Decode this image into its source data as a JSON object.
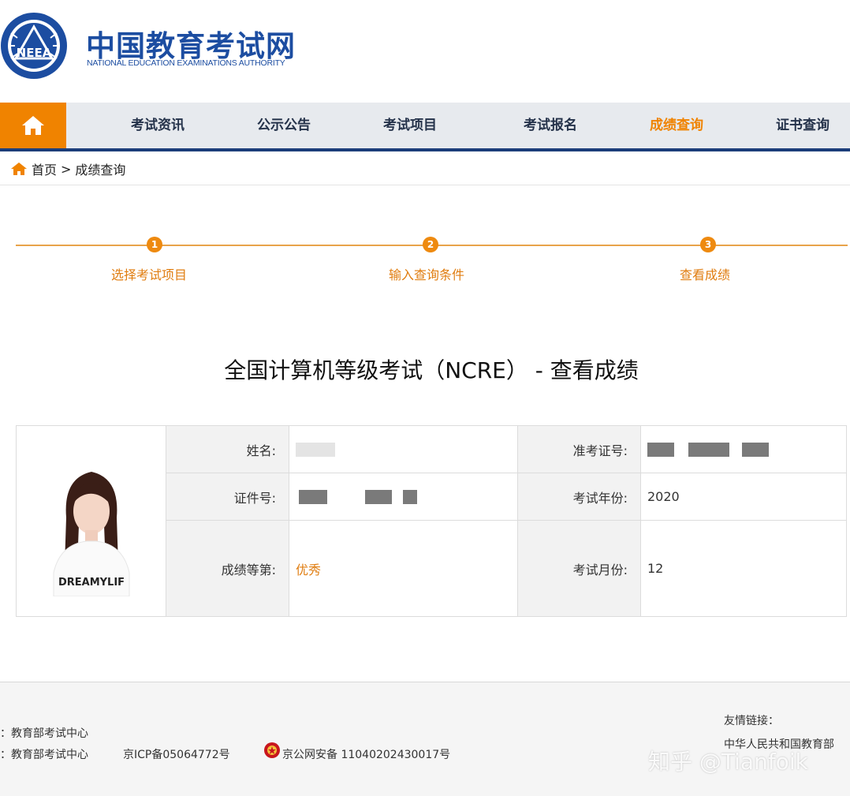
{
  "header": {
    "logo_text": "NEEA",
    "site_title": "中国教育考试网",
    "site_subtitle": "NATIONAL EDUCATION EXAMINATIONS AUTHORITY"
  },
  "nav": {
    "home_icon": "home-icon",
    "items": [
      {
        "label": "考试资讯"
      },
      {
        "label": "公示公告"
      },
      {
        "label": "考试项目"
      },
      {
        "label": "考试报名"
      },
      {
        "label": "成绩查询"
      },
      {
        "label": "证书查询"
      }
    ],
    "active_index": 4
  },
  "breadcrumb": {
    "home": "首页",
    "separator": ">",
    "current": "成绩查询"
  },
  "steps": [
    {
      "num": "1",
      "label": "选择考试项目"
    },
    {
      "num": "2",
      "label": "输入查询条件"
    },
    {
      "num": "3",
      "label": "查看成绩"
    }
  ],
  "result": {
    "title": "全国计算机等级考试（NCRE） - 查看成绩",
    "photo_shirt_text": "DREAMYLIF",
    "name_label": "姓名:",
    "name_value": "",
    "admission_label": "准考证号:",
    "id_label": "证件号:",
    "year_label": "考试年份:",
    "year_value": "2020",
    "grade_label": "成绩等第:",
    "grade_value": "优秀",
    "month_label": "考试月份:",
    "month_value": "12"
  },
  "footer": {
    "line1": "：教育部考试中心",
    "line2_org": "：教育部考试中心",
    "icp": "京ICP备05064772号",
    "police_icon": "police-badge-icon",
    "police": "京公网安备 11040202430017号",
    "links_label": "友情链接：",
    "link_moe": "中华人民共和国教育部"
  },
  "watermark": "知乎 @Tianfoik",
  "colors": {
    "brand_blue": "#1c4da1",
    "accent_orange": "#f08300",
    "nav_bg": "#e7eaee"
  }
}
